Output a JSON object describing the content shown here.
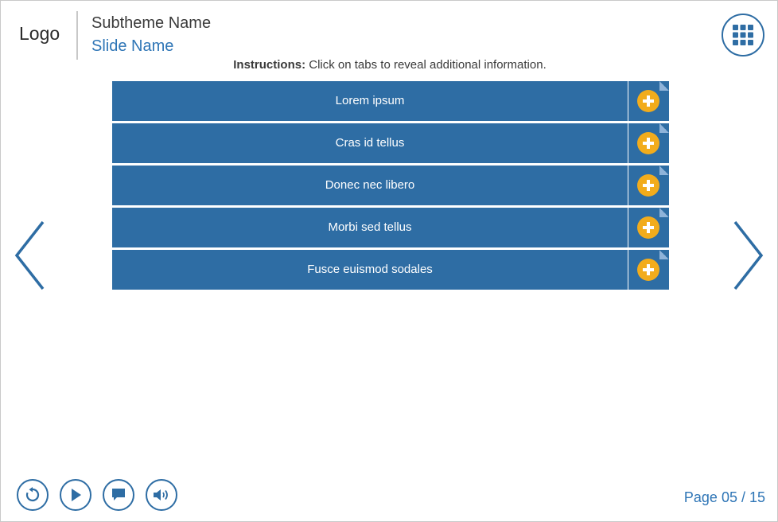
{
  "header": {
    "logo": "Logo",
    "subtheme": "Subtheme Name",
    "slide_name": "Slide Name"
  },
  "instructions": {
    "label": "Instructions:",
    "text": "Click on tabs to reveal additional information."
  },
  "tabs": [
    {
      "label": "Lorem ipsum"
    },
    {
      "label": "Cras id tellus"
    },
    {
      "label": "Donec nec libero"
    },
    {
      "label": "Morbi sed tellus"
    },
    {
      "label": "Fusce euismod sodales"
    }
  ],
  "footer": {
    "page_indicator": "Page 05 / 15"
  },
  "icons": {
    "menu": "grid-icon",
    "tab_expand": "plus-icon",
    "prev": "chevron-left-icon",
    "next": "chevron-right-icon",
    "replay": "replay-icon",
    "play": "play-icon",
    "caption": "caption-icon",
    "audio": "volume-icon"
  },
  "colors": {
    "primary": "#2e6da4",
    "accent": "#f2ac1c",
    "title_blue": "#2e75b6"
  }
}
